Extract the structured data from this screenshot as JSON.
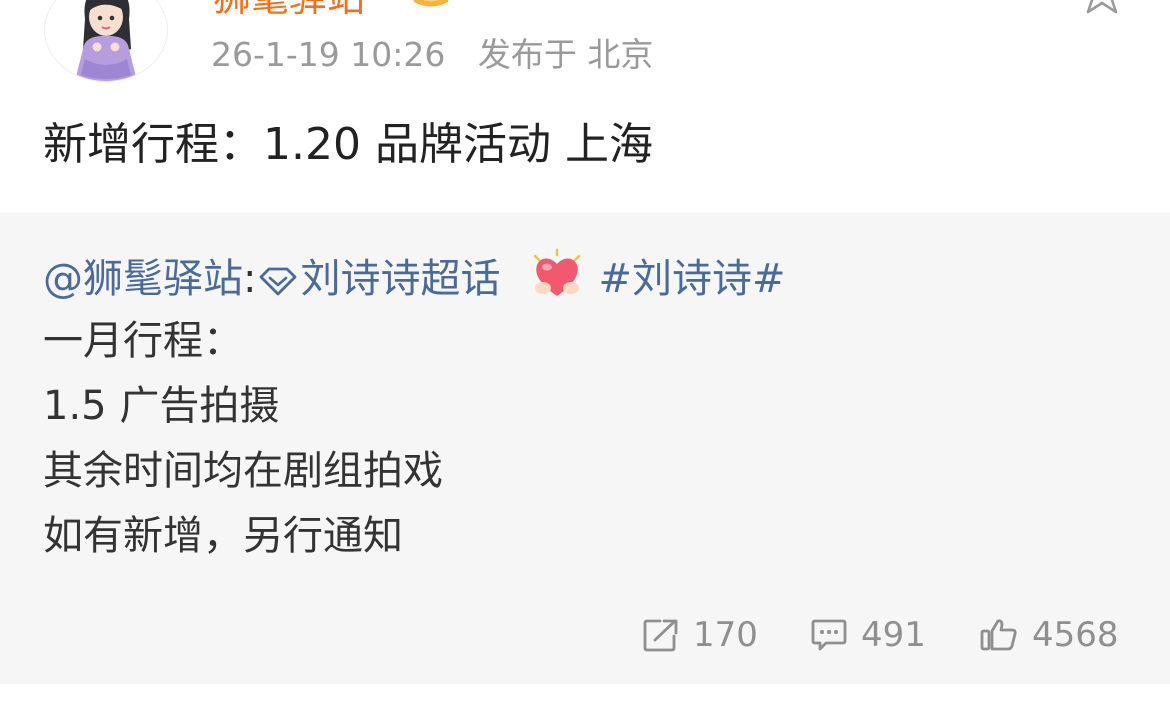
{
  "post": {
    "author": "狮髦驿站",
    "time": "26-1-19 10:26",
    "location": "发布于 北京",
    "text": "新增行程：1.20 品牌活动 上海"
  },
  "repost": {
    "mention": "@狮髦驿站",
    "colon": ":",
    "supertopic": "刘诗诗超话",
    "hashtag": "#刘诗诗#",
    "lines": [
      "一月行程：",
      "1.5 广告拍摄",
      "其余时间均在剧组拍戏",
      "如有新增，另行通知"
    ],
    "stats": {
      "shares": "170",
      "comments": "491",
      "likes": "4568"
    }
  },
  "colors": {
    "username": "#f2701a",
    "link": "#4a6a99",
    "meta_text": "#9a9a9a",
    "repost_bg": "#f6f6f6"
  },
  "icons": [
    "avatar",
    "vip-badge-icon",
    "star-icon",
    "supertopic-diamond-icon",
    "heart-emoji-icon",
    "share-icon",
    "comment-icon",
    "like-icon"
  ]
}
